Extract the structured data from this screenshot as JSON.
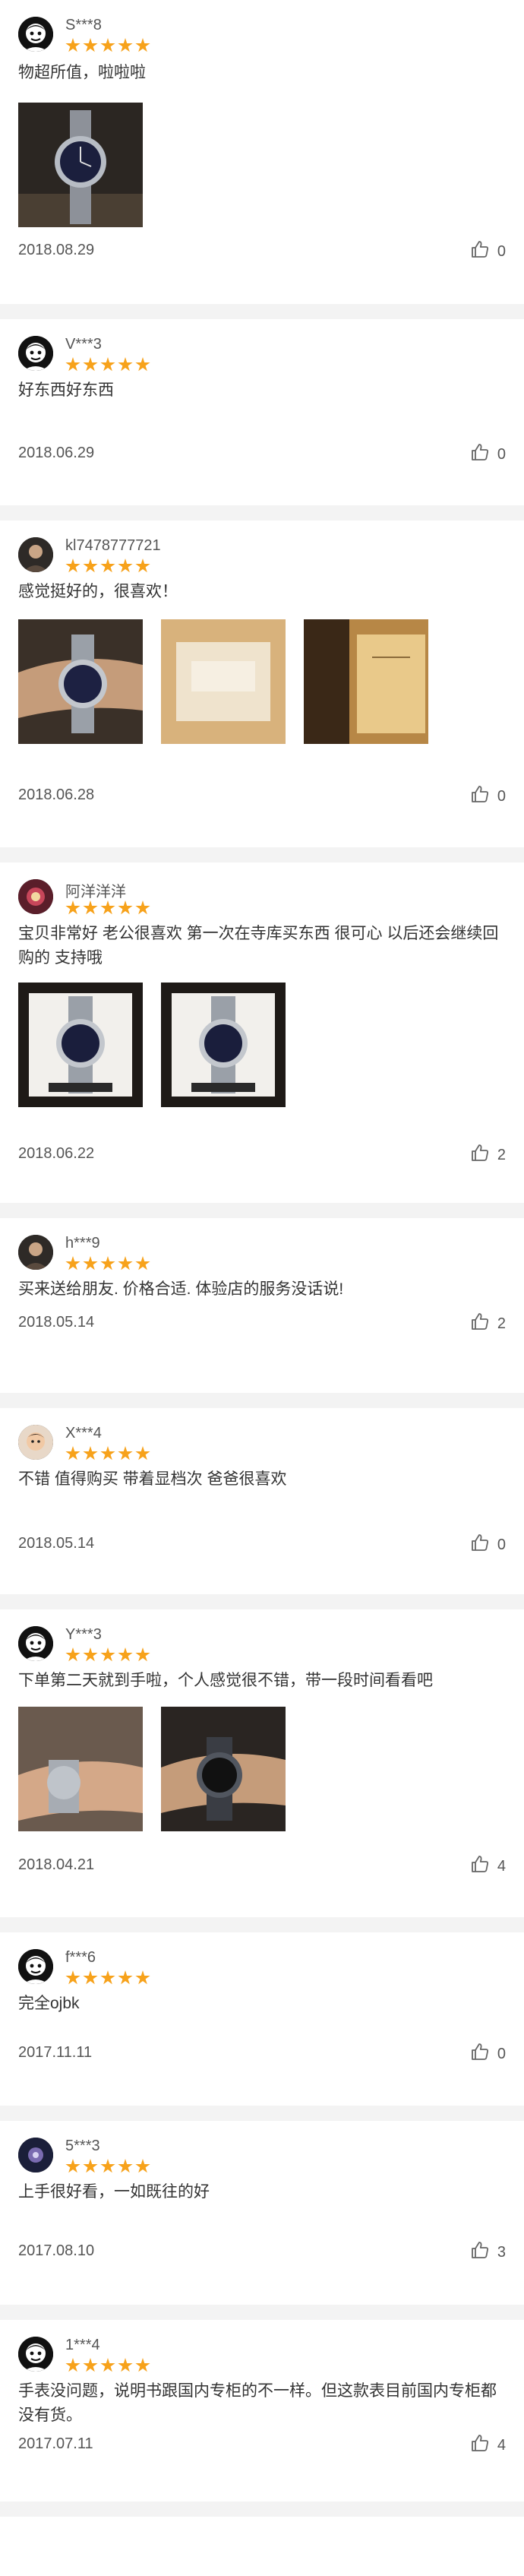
{
  "reviews": [
    {
      "user": "S***8",
      "avatar_icon": "cartoon-avatar-icon",
      "rating": 5,
      "text": "物超所值，啦啦啦",
      "images": [
        "watch-photo-dark-dial"
      ],
      "date": "2018.08.29",
      "likes": "0"
    },
    {
      "user": "V***3",
      "avatar_icon": "cartoon-avatar-icon",
      "rating": 5,
      "text": "好东西好东西",
      "images": [],
      "date": "2018.06.29",
      "likes": "0"
    },
    {
      "user": "kl7478777721",
      "avatar_icon": "portrait-avatar-icon",
      "rating": 5,
      "text": "感觉挺好的，很喜欢！",
      "images": [
        "watch-on-wrist-photo",
        "watch-box-photo",
        "warranty-card-photo"
      ],
      "date": "2018.06.28",
      "likes": "0"
    },
    {
      "user": "阿洋洋洋",
      "avatar_icon": "flower-avatar-icon",
      "rating": 5,
      "text": "宝贝非常好 老公很喜欢 第一次在寺库买东西 很可心 以后还会继续回购的 支持哦",
      "images": [
        "watch-in-case-photo",
        "watch-in-case-photo-2"
      ],
      "date": "2018.06.22",
      "likes": "2"
    },
    {
      "user": "h***9",
      "avatar_icon": "portrait-avatar-icon",
      "rating": 5,
      "text": "买来送给朋友. 价格合适. 体验店的服务没话说!",
      "images": [],
      "date": "2018.05.14",
      "likes": "2"
    },
    {
      "user": "X***4",
      "avatar_icon": "child-avatar-icon",
      "rating": 5,
      "text": "不错 值得购买 带着显档次 爸爸很喜欢",
      "images": [],
      "date": "2018.05.14",
      "likes": "0"
    },
    {
      "user": "Y***3",
      "avatar_icon": "cartoon-avatar-icon",
      "rating": 5,
      "text": "下单第二天就到手啦，个人感觉很不错，带一段时间看看吧",
      "images": [
        "watch-on-wrist-steel-photo",
        "watch-on-wrist-dark-photo"
      ],
      "date": "2018.04.21",
      "likes": "4"
    },
    {
      "user": "f***6",
      "avatar_icon": "cartoon-avatar-icon",
      "rating": 5,
      "text": "完全ojbk",
      "images": [],
      "date": "2017.11.11",
      "likes": "0"
    },
    {
      "user": "5***3",
      "avatar_icon": "dark-avatar-icon",
      "rating": 5,
      "text": "上手很好看，一如既往的好",
      "images": [],
      "date": "2017.08.10",
      "likes": "3"
    },
    {
      "user": "1***4",
      "avatar_icon": "cartoon-avatar-icon",
      "rating": 5,
      "text": "手表没问题，说明书跟国内专柜的不一样。但这款表目前国内专柜都没有货。",
      "images": [],
      "date": "2017.07.11",
      "likes": "4"
    }
  ],
  "icons": {
    "like": "thumbs-up-icon",
    "star": "star-icon"
  },
  "colors": {
    "star": "#f7a21b",
    "separator": "#f3f3f3",
    "text": "#333333",
    "meta": "#555555"
  }
}
